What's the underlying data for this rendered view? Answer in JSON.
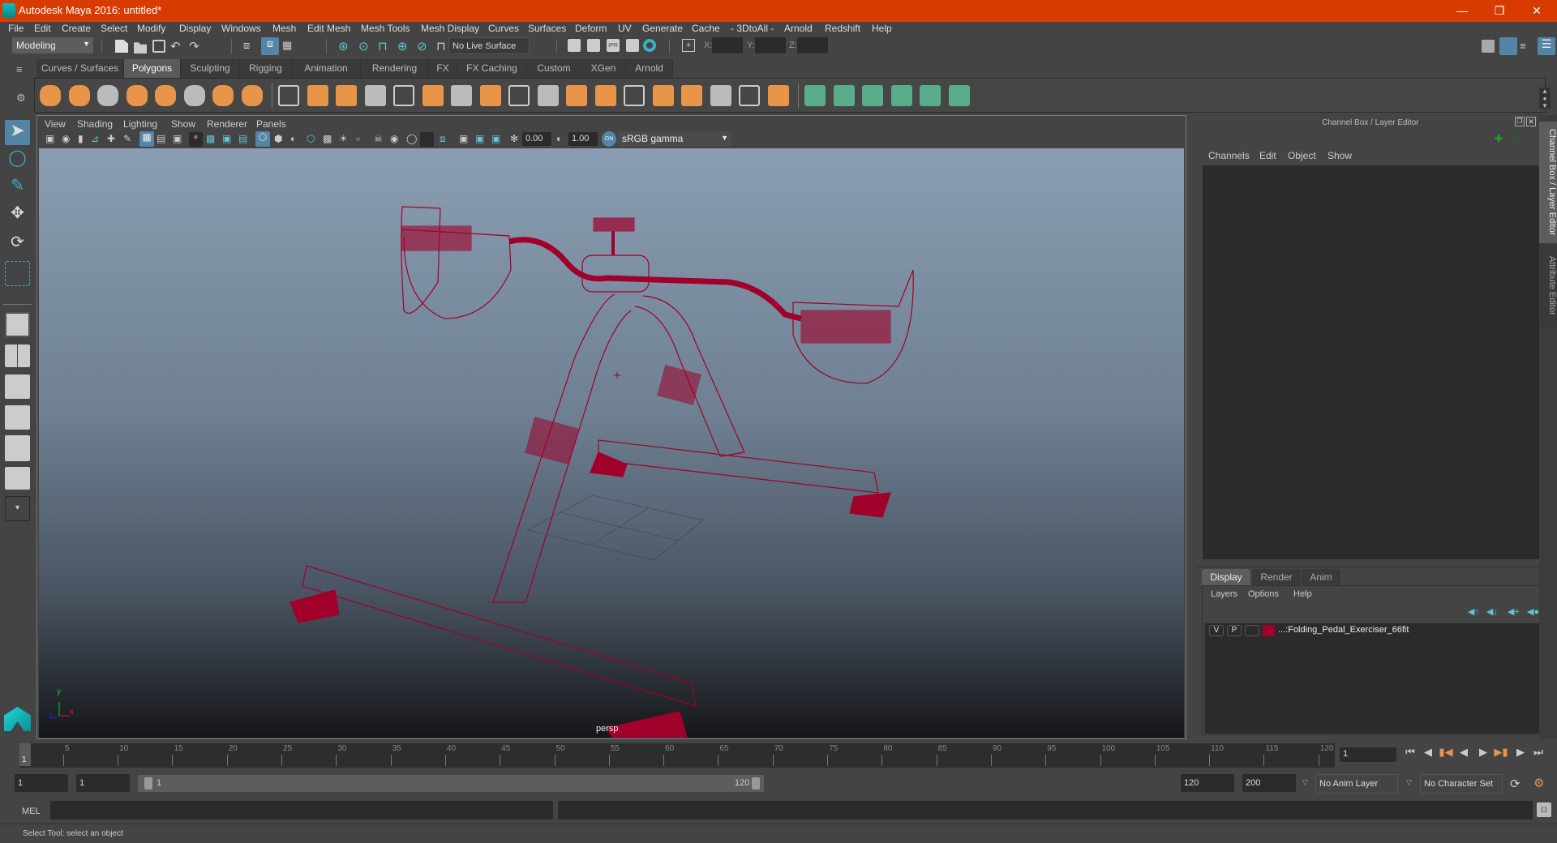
{
  "window": {
    "title": "Autodesk Maya 2016: untitled*",
    "controls": [
      "minimize",
      "restore",
      "close"
    ]
  },
  "menubar": [
    "File",
    "Edit",
    "Create",
    "Select",
    "Modify",
    "Display",
    "Windows",
    "Mesh",
    "Edit Mesh",
    "Mesh Tools",
    "Mesh Display",
    "Curves",
    "Surfaces",
    "Deform",
    "UV",
    "Generate",
    "Cache",
    "- 3DtoAll -",
    "Arnold",
    "Redshift",
    "Help"
  ],
  "statusline": {
    "mode": "Modeling",
    "live_surface": "No Live Surface",
    "x_label": "X:",
    "y_label": "Y:",
    "z_label": "Z:",
    "x_value": "",
    "y_value": "",
    "z_value": ""
  },
  "shelf": {
    "tabs": [
      "Curves / Surfaces",
      "Polygons",
      "Sculpting",
      "Rigging",
      "Animation",
      "Rendering",
      "FX",
      "FX Caching",
      "Custom",
      "XGen",
      "Arnold"
    ],
    "active_tab": "Polygons",
    "icons": [
      "poly-sphere",
      "poly-cube",
      "poly-cylinder",
      "poly-cone",
      "poly-plane",
      "poly-torus",
      "poly-pyramid",
      "poly-pipe",
      "combine",
      "separate",
      "mirror",
      "smooth",
      "extract",
      "boolean",
      "bevel",
      "bridge",
      "extrude",
      "multi-cut",
      "target-weld",
      "merge",
      "wedge",
      "circularize",
      "fill-hole",
      "collapse",
      "triangulate",
      "automatic-uv",
      "planar-uv",
      "cylindrical-uv",
      "spherical-uv",
      "uv-editor",
      "unfold",
      "layout-uv"
    ],
    "accent_orange": "#e8954a",
    "accent_green": "#5aad8a"
  },
  "viewport": {
    "menus": [
      "View",
      "Shading",
      "Lighting",
      "Show",
      "Renderer",
      "Panels"
    ],
    "exposure": "0.00",
    "gamma": "1.00",
    "color_space": "sRGB gamma",
    "camera_label": "persp",
    "axis": {
      "x": "x",
      "y": "y",
      "z": "z"
    },
    "wire_color": "#a0002a"
  },
  "channel_box": {
    "title": "Channel Box / Layer Editor",
    "menus": [
      "Channels",
      "Edit",
      "Object",
      "Show"
    ]
  },
  "layer_editor": {
    "tabs": [
      "Display",
      "Render",
      "Anim"
    ],
    "active_tab": "Display",
    "menus": [
      "Layers",
      "Options",
      "Help"
    ],
    "layers": [
      {
        "visible": "V",
        "playback": "P",
        "color": "#a0002a",
        "name": "...:Folding_Pedal_Exerciser_66fit"
      }
    ]
  },
  "side_tabs": [
    "Channel Box / Layer Editor",
    "Attribute Editor"
  ],
  "timeline": {
    "start_marker": "1",
    "ticks": [
      "5",
      "10",
      "15",
      "20",
      "25",
      "30",
      "35",
      "40",
      "45",
      "50",
      "55",
      "60",
      "65",
      "70",
      "75",
      "80",
      "85",
      "90",
      "95",
      "100",
      "105",
      "110",
      "115",
      "120"
    ],
    "current_frame": "1"
  },
  "range": {
    "start": "1",
    "playback_start": "1",
    "range_start_label": "1",
    "range_end_label": "120",
    "playback_end": "120",
    "end": "200",
    "anim_layer": "No Anim Layer",
    "character_set": "No Character Set"
  },
  "command_line": {
    "label": "MEL",
    "value": ""
  },
  "help_line": "Select Tool: select an object"
}
